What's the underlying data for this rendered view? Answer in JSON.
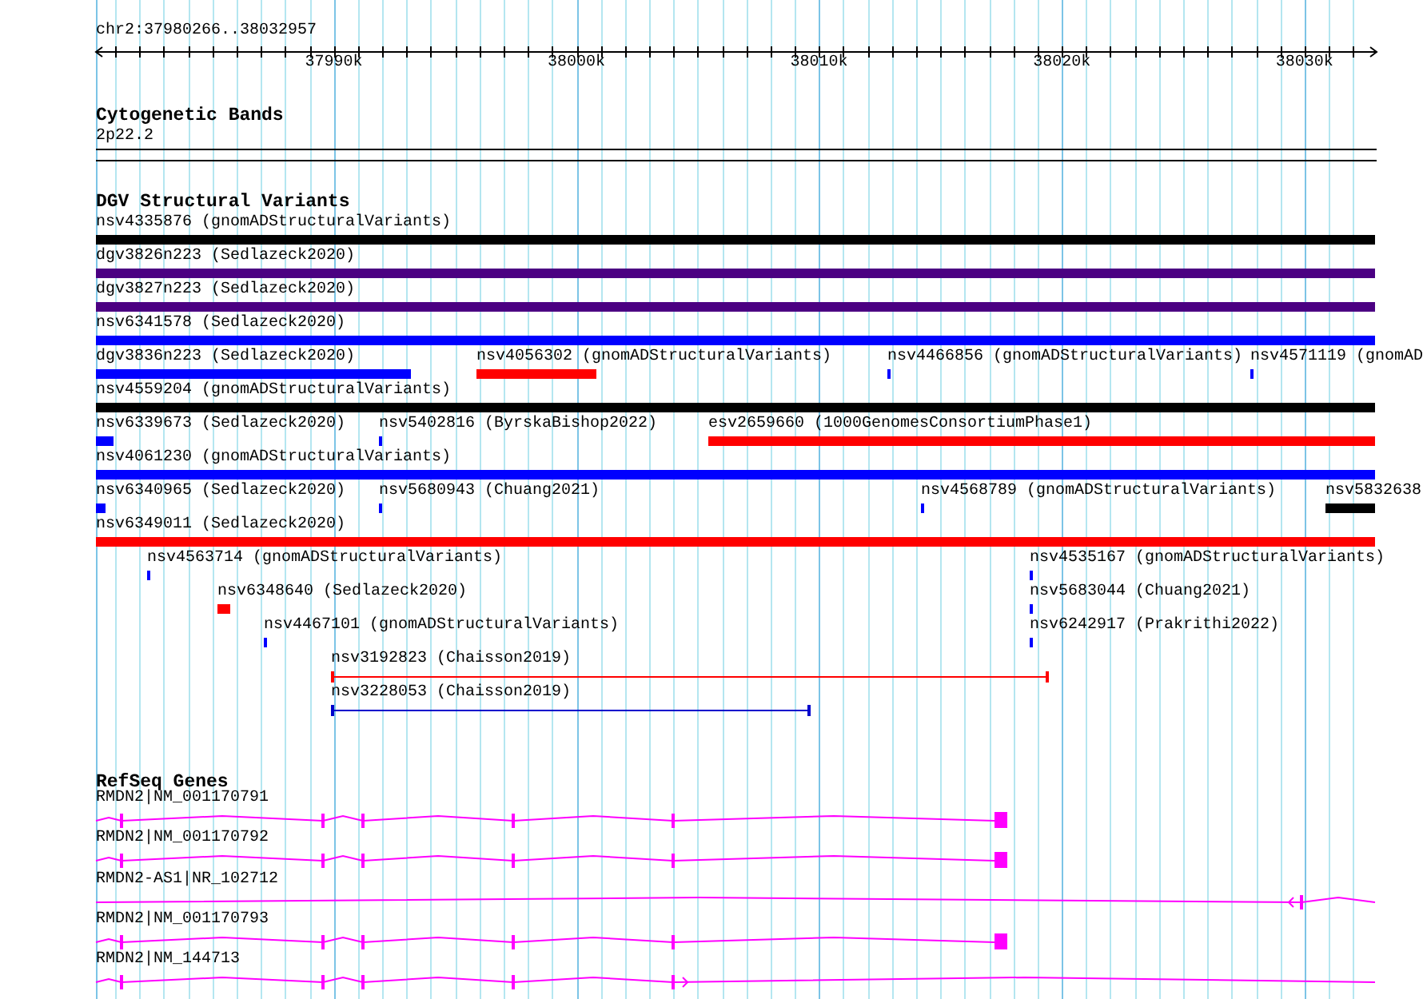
{
  "location": "chr2:37980266..38032957",
  "ruler": {
    "ticks": [
      "37990k",
      "38000k",
      "38010k",
      "38020k",
      "38030k"
    ]
  },
  "tracks": [
    {
      "kind": "cytoband",
      "title": "Cytogenetic Bands",
      "bands": [
        {
          "label": "2p22.2"
        }
      ]
    },
    {
      "kind": "variants",
      "title": "DGV Structural Variants",
      "features": [
        {
          "label": "nsv4335876 (gnomADStructuralVariants)",
          "color": "#000000",
          "kind": "bar"
        },
        {
          "label": "dgv3826n223 (Sedlazeck2020)",
          "color": "#4b0082",
          "kind": "bar"
        },
        {
          "label": "dgv3827n223 (Sedlazeck2020)",
          "color": "#4b0082",
          "kind": "bar"
        },
        {
          "label": "nsv6341578 (Sedlazeck2020)",
          "color": "#0000ff",
          "kind": "bar"
        },
        {
          "label": "dgv3836n223 (Sedlazeck2020)",
          "color": "#0000ff",
          "kind": "bar"
        },
        {
          "label": "nsv4056302 (gnomADStructuralVariants)",
          "color": "#ff0000",
          "kind": "bar"
        },
        {
          "label": "nsv4466856 (gnomADStructuralVariants)",
          "color": "#0000ff",
          "kind": "bar"
        },
        {
          "label": "nsv4571119 (gnomAD",
          "color": "#0000ff",
          "kind": "bar"
        },
        {
          "label": "nsv4559204 (gnomADStructuralVariants)",
          "color": "#000000",
          "kind": "bar"
        },
        {
          "label": "nsv6339673 (Sedlazeck2020)",
          "color": "#0000ff",
          "kind": "bar"
        },
        {
          "label": "nsv5402816 (ByrskaBishop2022)",
          "color": "#0000ff",
          "kind": "bar"
        },
        {
          "label": "esv2659660 (1000GenomesConsortiumPhase1)",
          "color": "#ff0000",
          "kind": "bar"
        },
        {
          "label": "nsv4061230 (gnomADStructuralVariants)",
          "color": "#0000ff",
          "kind": "bar"
        },
        {
          "label": "nsv6340965 (Sedlazeck2020)",
          "color": "#0000ff",
          "kind": "bar"
        },
        {
          "label": "nsv5680943 (Chuang2021)",
          "color": "#0000ff",
          "kind": "bar"
        },
        {
          "label": "nsv4568789 (gnomADStructuralVariants)",
          "color": "#0000ff",
          "kind": "bar"
        },
        {
          "label": "nsv5832638",
          "color": "#000000",
          "kind": "bar"
        },
        {
          "label": "nsv6349011 (Sedlazeck2020)",
          "color": "#ff0000",
          "kind": "bar"
        },
        {
          "label": "nsv4563714 (gnomADStructuralVariants)",
          "color": "#0000ff",
          "kind": "bar"
        },
        {
          "label": "nsv4535167 (gnomADStructuralVariants)",
          "color": "#0000ff",
          "kind": "bar"
        },
        {
          "label": "nsv6348640 (Sedlazeck2020)",
          "color": "#ff0000",
          "kind": "bar"
        },
        {
          "label": "nsv5683044 (Chuang2021)",
          "color": "#0000ff",
          "kind": "bar"
        },
        {
          "label": "nsv4467101 (gnomADStructuralVariants)",
          "color": "#0000ff",
          "kind": "bar"
        },
        {
          "label": "nsv6242917 (Prakrithi2022)",
          "color": "#0000ff",
          "kind": "bar"
        },
        {
          "label": "nsv3192823 (Chaisson2019)",
          "color": "#ff0000",
          "kind": "span"
        },
        {
          "label": "nsv3228053 (Chaisson2019)",
          "color": "#0000cc",
          "kind": "span"
        }
      ]
    },
    {
      "kind": "genes",
      "title": "RefSeq Genes",
      "genes": [
        {
          "label": "RMDN2|NM_001170791"
        },
        {
          "label": "RMDN2|NM_001170792"
        },
        {
          "label": "RMDN2-AS1|NR_102712"
        },
        {
          "label": "RMDN2|NM_001170793"
        },
        {
          "label": "RMDN2|NM_144713"
        }
      ]
    }
  ]
}
